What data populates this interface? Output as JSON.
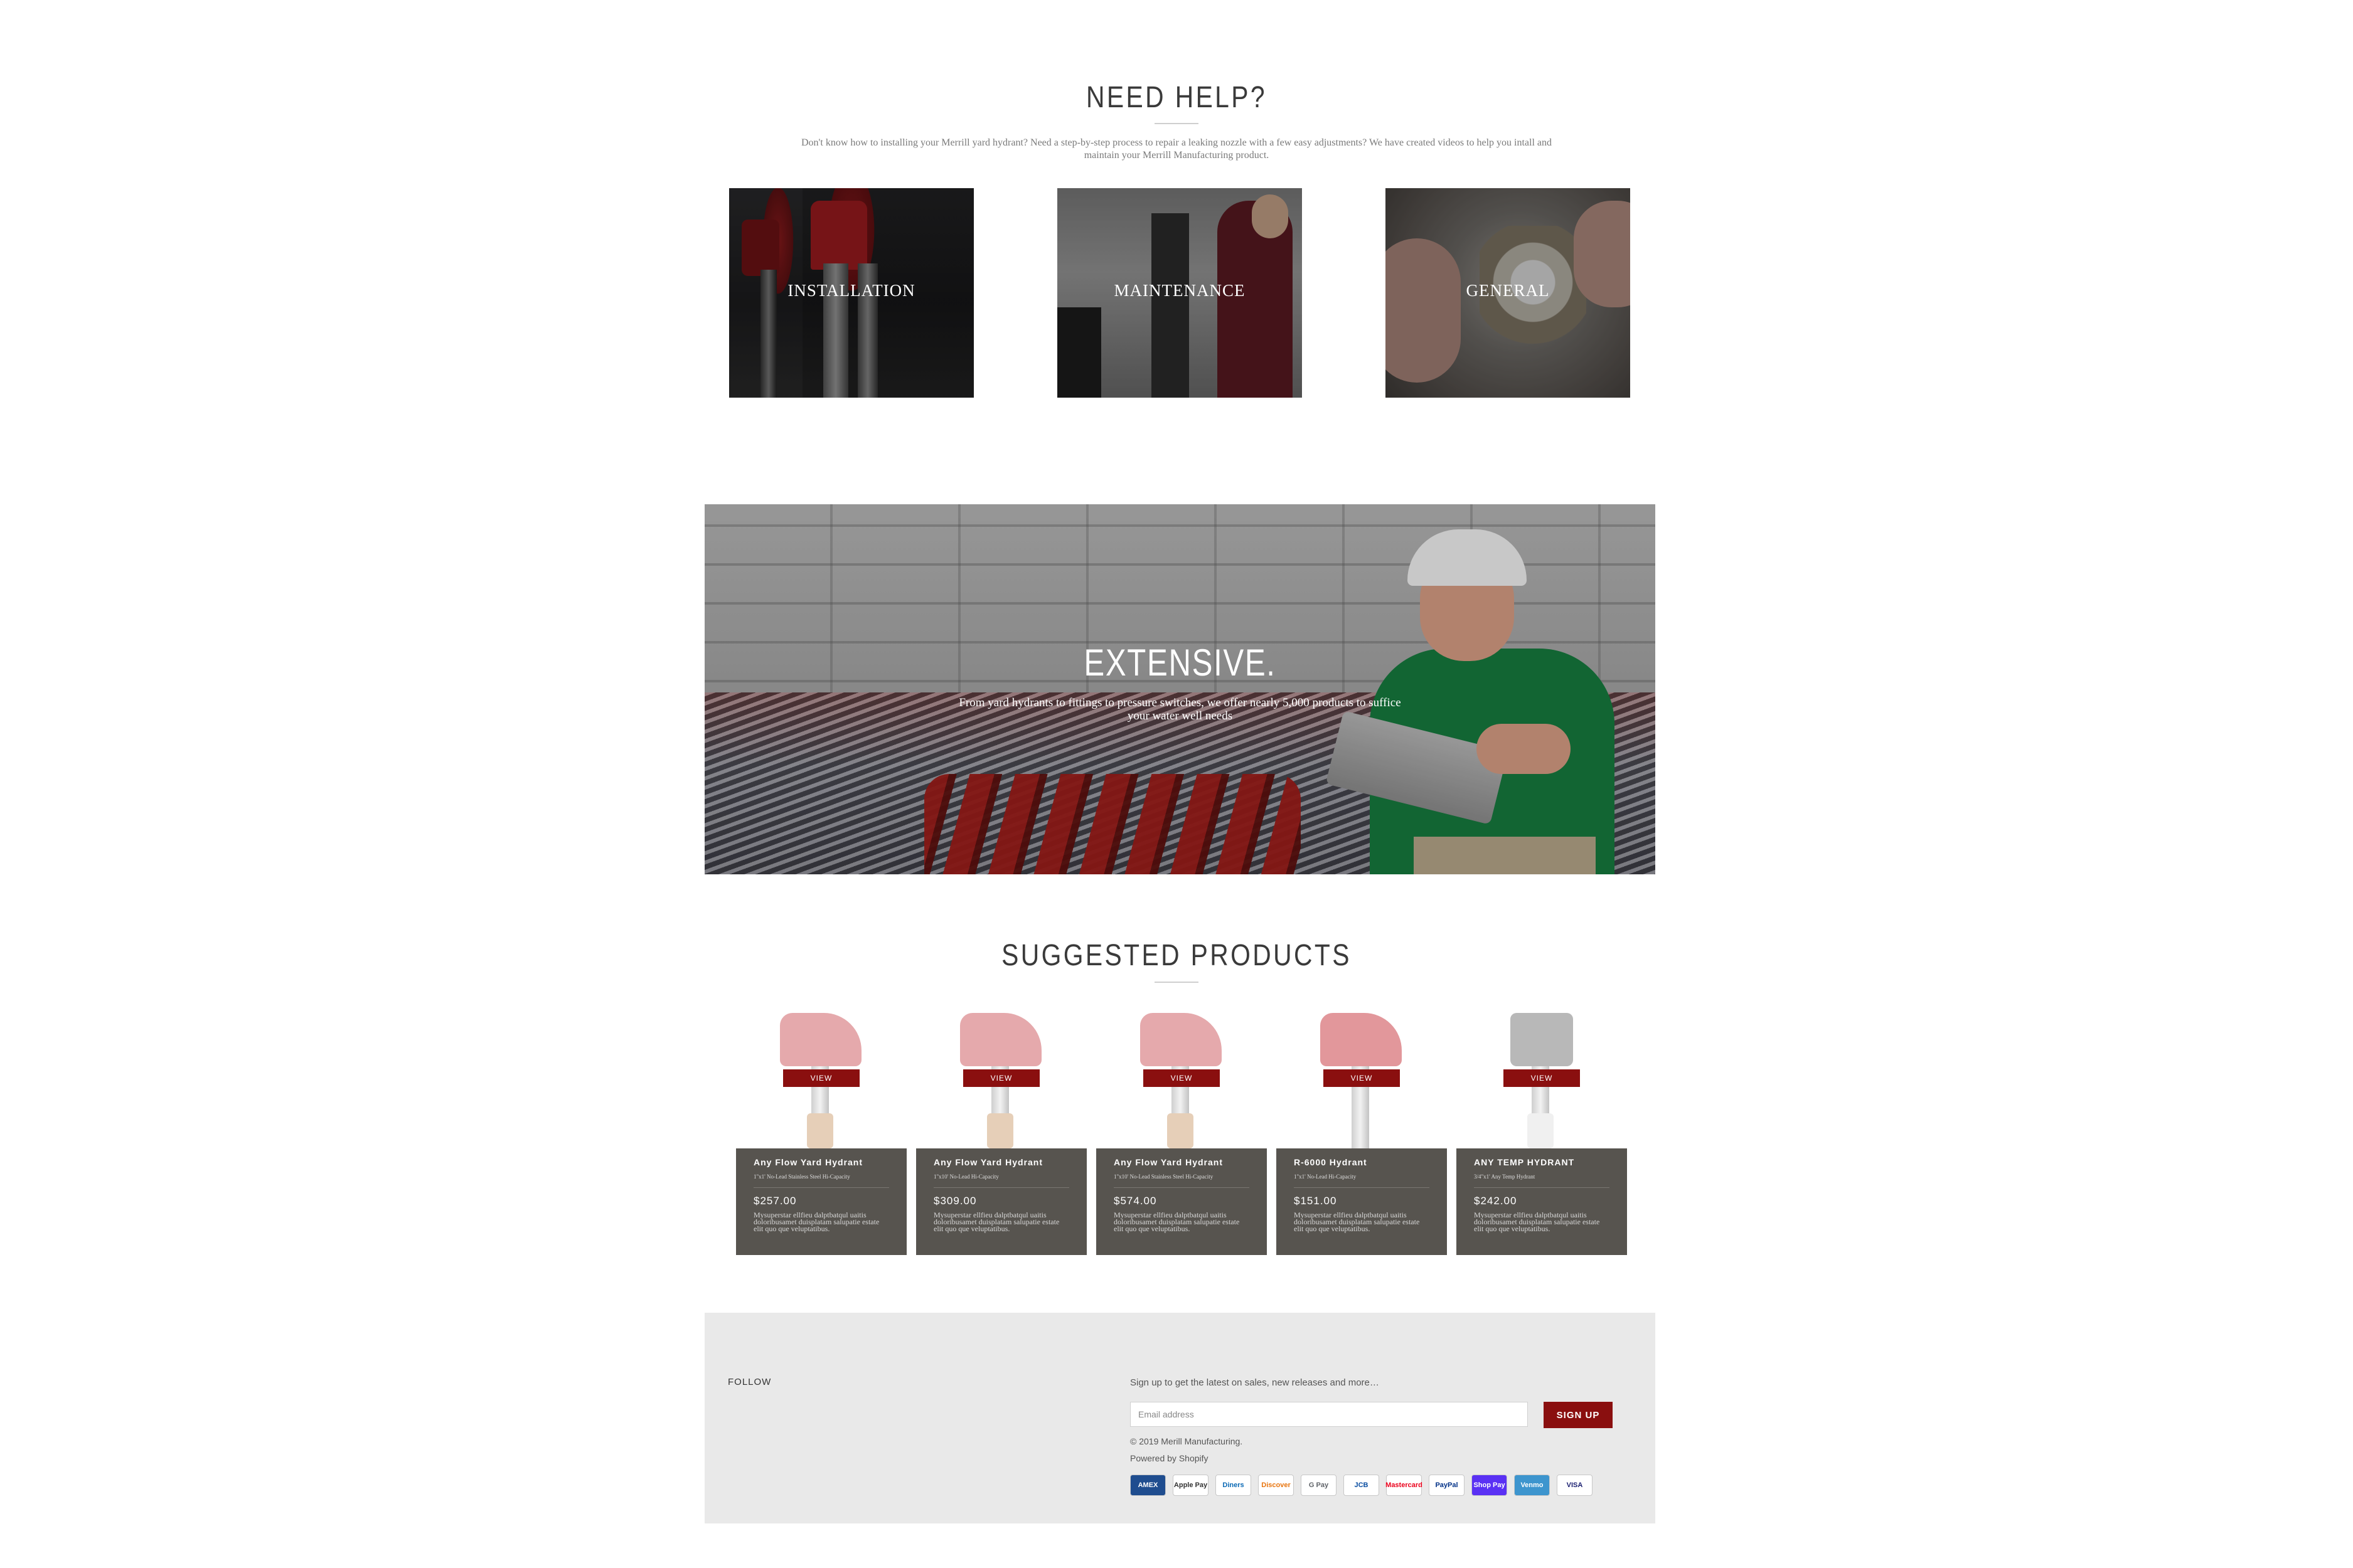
{
  "help": {
    "title": "NEED HELP?",
    "description": "Don't know how to installing your Merrill yard hydrant? Need a step-by-step process to repair a leaking nozzle with a few easy adjustments? We have created videos to help you intall and maintain your Merrill Manufacturing product.",
    "cards": [
      {
        "label": "INSTALLATION"
      },
      {
        "label": "MAINTENANCE"
      },
      {
        "label": "GENERAL"
      }
    ]
  },
  "hero": {
    "title": "EXTENSIVE.",
    "subtitle": "From yard hydrants to fittings to pressure switches, we offer nearly 5,000 products to suffice your water well needs"
  },
  "products": {
    "title": "SUGGESTED PRODUCTS",
    "view_label": "VIEW",
    "items": [
      {
        "name": "Any Flow Yard Hydrant",
        "sub": "1\"x1' No-Lead Stainless Steel Hi-Capacity",
        "price": "$257.00",
        "desc": "Mysuperstar ellfieu dalptbatqul uaitis doloribusamet duisplatam salupatie estate elit quo que veluptatibus."
      },
      {
        "name": "Any Flow Yard Hydrant",
        "sub": "1\"x10' No-Lead Hi-Capacity",
        "price": "$309.00",
        "desc": "Mysuperstar ellfieu dalptbatqul uaitis doloribusamet duisplatam salupatie estate elit quo que veluptatibus."
      },
      {
        "name": "Any Flow Yard Hydrant",
        "sub": "1\"x10' No-Lead Stainless Steel Hi-Capacity",
        "price": "$574.00",
        "desc": "Mysuperstar ellfieu dalptbatqul uaitis doloribusamet duisplatam salupatie estate elit quo que veluptatibus."
      },
      {
        "name": "R-6000 Hydrant",
        "sub": "1\"x1' No-Lead Hi-Capacity",
        "price": "$151.00",
        "desc": "Mysuperstar ellfieu dalptbatqul uaitis doloribusamet duisplatam salupatie estate elit quo que veluptatibus."
      },
      {
        "name": "ANY TEMP HYDRANT",
        "sub": "3/4\"x1' Any Temp Hydrant",
        "price": "$242.00",
        "desc": "Mysuperstar ellfieu dalptbatqul uaitis doloribusamet duisplatam salupatie estate elit quo que veluptatibus."
      }
    ]
  },
  "footer": {
    "follow": "FOLLOW",
    "signup_text": "Sign up to get the latest on sales, new releases and more…",
    "email_placeholder": "Email address",
    "signup_button": "SIGN UP",
    "copyright": "© 2019 Merill Manufacturing.",
    "powered": "Powered by Shopify",
    "payments": [
      "AMEX",
      "Apple Pay",
      "Diners",
      "Discover",
      "G Pay",
      "JCB",
      "Mastercard",
      "PayPal",
      "Shop Pay",
      "Venmo",
      "VISA"
    ],
    "payment_icons": [
      "amex-icon",
      "apple-pay-icon",
      "diners-club-icon",
      "discover-icon",
      "google-pay-icon",
      "jcb-icon",
      "mastercard-icon",
      "paypal-icon",
      "shop-pay-icon",
      "venmo-icon",
      "visa-icon"
    ]
  },
  "colors": {
    "accent": "#8a0f0f",
    "card": "#57544f",
    "footer_bg": "#e9e9e9"
  }
}
